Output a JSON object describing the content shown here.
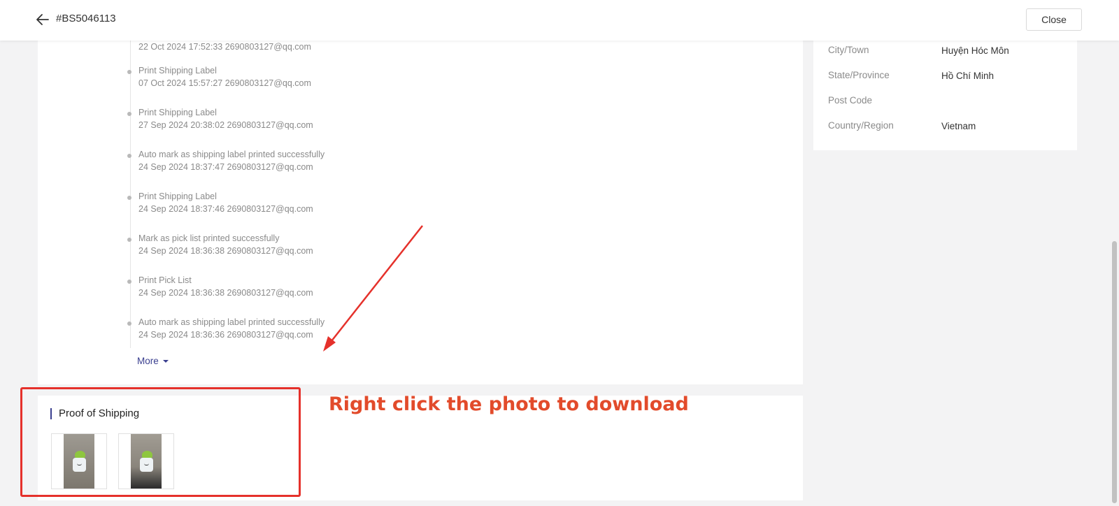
{
  "header": {
    "order_id": "#BS5046113",
    "close_label": "Close"
  },
  "timeline": {
    "entries": [
      {
        "action": "",
        "meta": "22 Oct 2024 17:52:33 2690803127@qq.com"
      },
      {
        "action": "Print Shipping Label",
        "meta": "07 Oct 2024 15:57:27 2690803127@qq.com"
      },
      {
        "action": "Print Shipping Label",
        "meta": "27 Sep 2024 20:38:02 2690803127@qq.com"
      },
      {
        "action": "Auto mark as shipping label printed successfully",
        "meta": "24 Sep 2024 18:37:47 2690803127@qq.com"
      },
      {
        "action": "Print Shipping Label",
        "meta": "24 Sep 2024 18:37:46 2690803127@qq.com"
      },
      {
        "action": "Mark as pick list printed successfully",
        "meta": "24 Sep 2024 18:36:38 2690803127@qq.com"
      },
      {
        "action": "Print Pick List",
        "meta": "24 Sep 2024 18:36:38 2690803127@qq.com"
      },
      {
        "action": "Auto mark as shipping label printed successfully",
        "meta": "24 Sep 2024 18:36:36 2690803127@qq.com"
      }
    ],
    "more_label": "More"
  },
  "address": {
    "fields": [
      {
        "label": "City/Town",
        "value": "Huyện Hóc Môn"
      },
      {
        "label": "State/Province",
        "value": "Hồ Chí Minh"
      },
      {
        "label": "Post Code",
        "value": ""
      },
      {
        "label": "Country/Region",
        "value": "Vietnam"
      }
    ]
  },
  "proof": {
    "title": "Proof of Shipping"
  },
  "annotation": {
    "hint": "Right click the photo to download",
    "color": "#e5312b"
  },
  "colors": {
    "accent": "#3a3f8f"
  }
}
